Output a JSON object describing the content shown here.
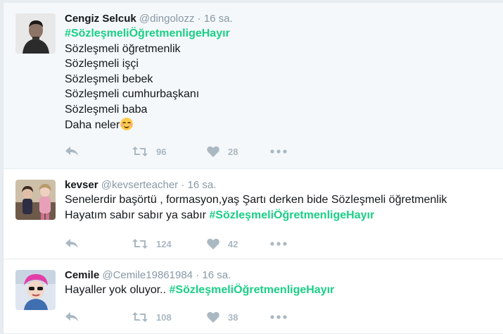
{
  "tweets": [
    {
      "name": "Cengiz Selcuk",
      "handle": "@dingolozz",
      "dot": "·",
      "time": "16 sa.",
      "hashtag": "#SözleşmeliÖğretmenligeHayır",
      "lines": [
        "Sözleşmeli öğretmenlik",
        "Sözleşmeli işçi",
        "Sözleşmeli bebek",
        "Sözleşmeli cumhurbaşkanı",
        "Sözleşmeli baba",
        "Daha neler"
      ],
      "emoji": "smiling-face-with-blush-icon",
      "retweets": "96",
      "likes": "28"
    },
    {
      "name": "kevser",
      "handle": "@kevserteacher",
      "dot": "·",
      "time": "16 sa.",
      "line1": "Senelerdir başörtü , formasyon,yaş Şartı derken bide Sözleşmeli öğretmenlik",
      "line2": "Hayatım sabır sabır ya sabır ",
      "hashtag": "#SözleşmeliÖğretmenligeHayır",
      "retweets": "124",
      "likes": "42"
    },
    {
      "name": "Cemile",
      "handle": "@Cemile19861984",
      "dot": "·",
      "time": "16 sa.",
      "line1": "Hayaller yok oluyor.. ",
      "hashtag": "#SözleşmeliÖğretmenligeHayır",
      "retweets": "108",
      "likes": "38"
    }
  ],
  "colors": {
    "hashtag": "#19cf86",
    "muted": "#8899a6",
    "action_icon": "#aab8c2",
    "selected_background": "#f5f8fa"
  },
  "icons": [
    "reply-icon",
    "retweet-icon",
    "heart-icon",
    "more-icon"
  ]
}
